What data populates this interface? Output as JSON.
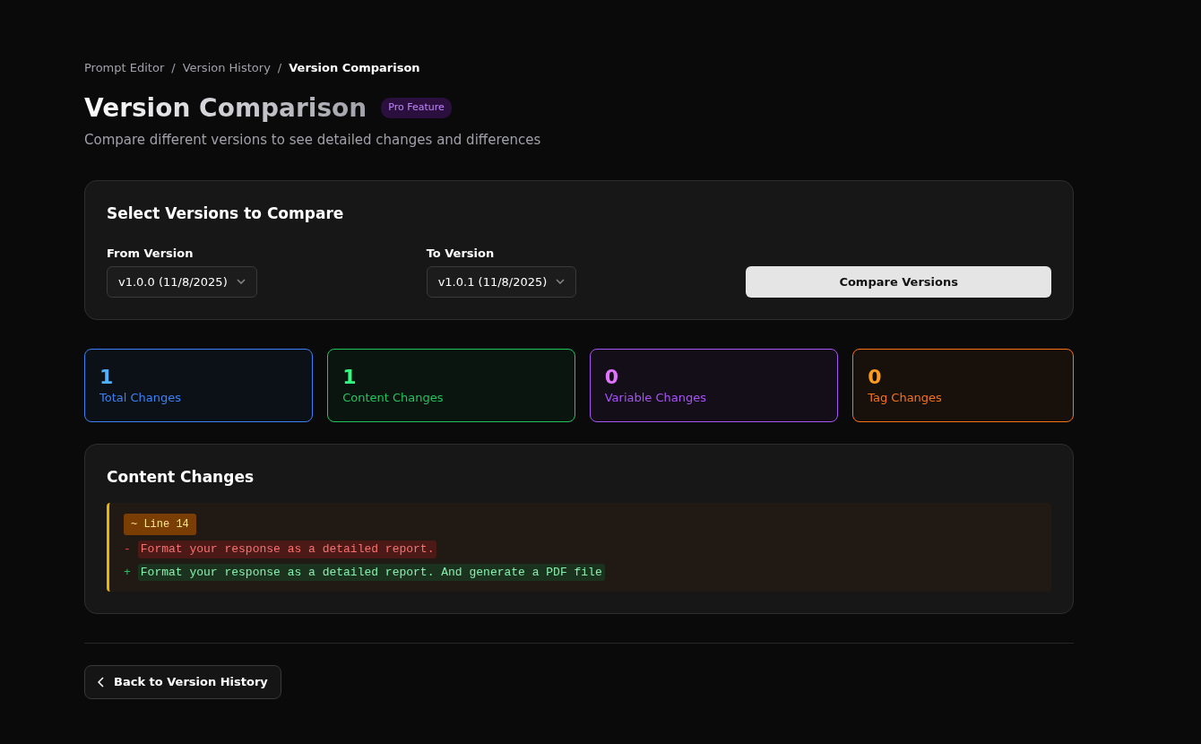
{
  "breadcrumb": [
    {
      "label": "Prompt Editor",
      "current": false
    },
    {
      "label": "Version History",
      "current": false
    },
    {
      "label": "Version Comparison",
      "current": true
    }
  ],
  "separator": "/",
  "title": "Version Comparison",
  "badge": "Pro Feature",
  "subtitle": "Compare different versions to see detailed changes and differences",
  "selector": {
    "title": "Select Versions to Compare",
    "from": {
      "label": "From Version",
      "value": "v1.0.0 (11/8/2025)"
    },
    "to": {
      "label": "To Version",
      "value": "v1.0.1 (11/8/2025)"
    },
    "button": "Compare Versions"
  },
  "stats": [
    {
      "value": "1",
      "label": "Total Changes",
      "color": "#3b82f6"
    },
    {
      "value": "1",
      "label": "Content Changes",
      "color": "#22c55e"
    },
    {
      "value": "0",
      "label": "Variable Changes",
      "color": "#a855f7"
    },
    {
      "value": "0",
      "label": "Tag Changes",
      "color": "#f97316"
    }
  ],
  "changes": {
    "title": "Content Changes",
    "hunks": [
      {
        "label": "~ Line 14",
        "lines": [
          {
            "kind": "removed",
            "sign": "-",
            "text": "Format your response as a detailed report."
          },
          {
            "kind": "added",
            "sign": "+",
            "text": "Format your response as a detailed report. And generate a PDF file"
          }
        ]
      }
    ]
  },
  "back_button": "Back to Version History"
}
